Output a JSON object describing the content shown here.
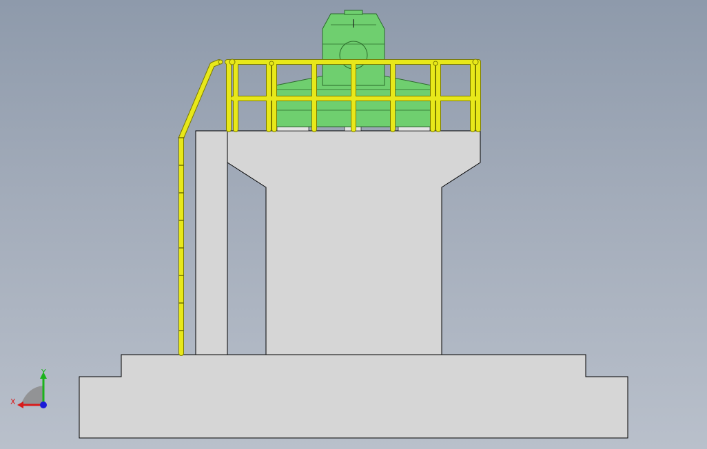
{
  "viewport": {
    "background_top": "#8e9aab",
    "background_bottom": "#b9c0cb"
  },
  "model": {
    "concrete_color": "#d6d6d6",
    "edge_color": "#000000",
    "equipment_color": "#6fcf6f",
    "equipment_edge": "#2a6a2a",
    "railing_color": "#e8e81a",
    "railing_edge": "#7a7a00"
  },
  "triad": {
    "x_label": "X",
    "y_label": "Y",
    "x_color": "#d81b1b",
    "y_color": "#1bb31b",
    "z_color": "#1b1bd8"
  }
}
